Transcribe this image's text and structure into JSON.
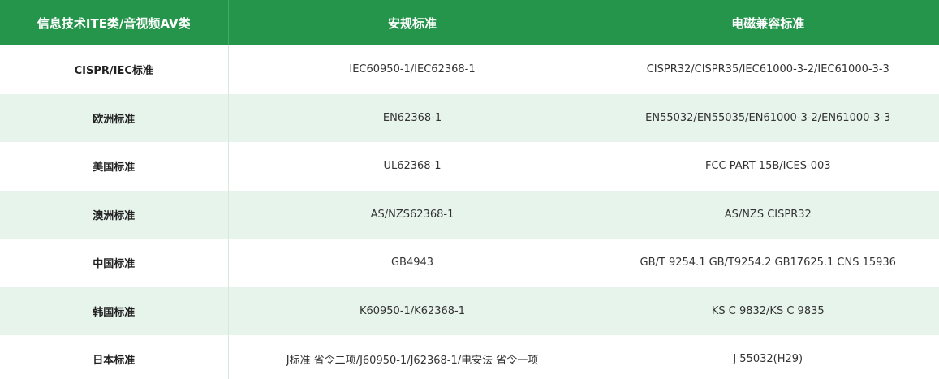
{
  "table": {
    "headers": [
      "信息技术ITE类/音视频AV类",
      "安规标准",
      "电磁兼容标准"
    ],
    "rows": [
      {
        "region": "CISPR/IEC标准",
        "safety": "IEC60950-1/IEC62368-1",
        "emc": "CISPR32/CISPR35/IEC61000-3-2/IEC61000-3-3"
      },
      {
        "region": "欧洲标准",
        "safety": "EN62368-1",
        "emc": "EN55032/EN55035/EN61000-3-2/EN61000-3-3"
      },
      {
        "region": "美国标准",
        "safety": "UL62368-1",
        "emc": "FCC PART 15B/ICES-003"
      },
      {
        "region": "澳洲标准",
        "safety": "AS/NZS62368-1",
        "emc": "AS/NZS CISPR32"
      },
      {
        "region": "中国标准",
        "safety": "GB4943",
        "emc": "GB/T 9254.1 GB/T9254.2 GB17625.1 CNS 15936"
      },
      {
        "region": "韩国标准",
        "safety": "K60950-1/K62368-1",
        "emc": "KS C 9832/KS C 9835"
      },
      {
        "region": "日本标准",
        "safety": "J标准 省令二项/J60950-1/J62368-1/电安法 省令一项",
        "emc": "J 55032(H29)"
      }
    ]
  },
  "colors": {
    "header_bg": "#24954a",
    "header_text": "#ffffff",
    "stripe_bg": "#e7f4ec"
  }
}
